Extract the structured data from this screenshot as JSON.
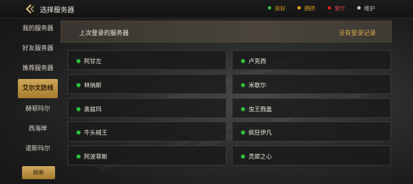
{
  "header": {
    "title": "选择服务器",
    "legend": [
      {
        "label": "良好",
        "color": "#2fbf3a"
      },
      {
        "label": "拥挤",
        "color": "#e0a020"
      },
      {
        "label": "繁忙",
        "color": "#d02525"
      },
      {
        "label": "维护",
        "color": "#c8c8c8"
      }
    ]
  },
  "sidebar": {
    "items": [
      {
        "label": "我的服务器",
        "active": false
      },
      {
        "label": "好友服务器",
        "active": false
      },
      {
        "label": "推荐服务器",
        "active": false
      },
      {
        "label": "艾尔文防线",
        "active": true
      },
      {
        "label": "赫顿玛尔",
        "active": false
      },
      {
        "label": "西海岸",
        "active": false
      },
      {
        "label": "诺斯玛尔",
        "active": false
      }
    ],
    "refresh_label": "刷新"
  },
  "recent": {
    "title": "上次登录的服务器",
    "empty_text": "没有登录记录"
  },
  "servers": [
    {
      "name": "阿甘左",
      "status": "良好"
    },
    {
      "name": "卢克西",
      "status": "良好"
    },
    {
      "name": "林纳斯",
      "status": "良好"
    },
    {
      "name": "米歇尔",
      "status": "良好"
    },
    {
      "name": "奥兹玛",
      "status": "良好"
    },
    {
      "name": "虫王戮蛊",
      "status": "良好"
    },
    {
      "name": "牛头械王",
      "status": "良好"
    },
    {
      "name": "疯狂伊凡",
      "status": "良好"
    },
    {
      "name": "阿波菲斯",
      "status": "良好"
    },
    {
      "name": "灵犀之心",
      "status": "良好"
    }
  ]
}
